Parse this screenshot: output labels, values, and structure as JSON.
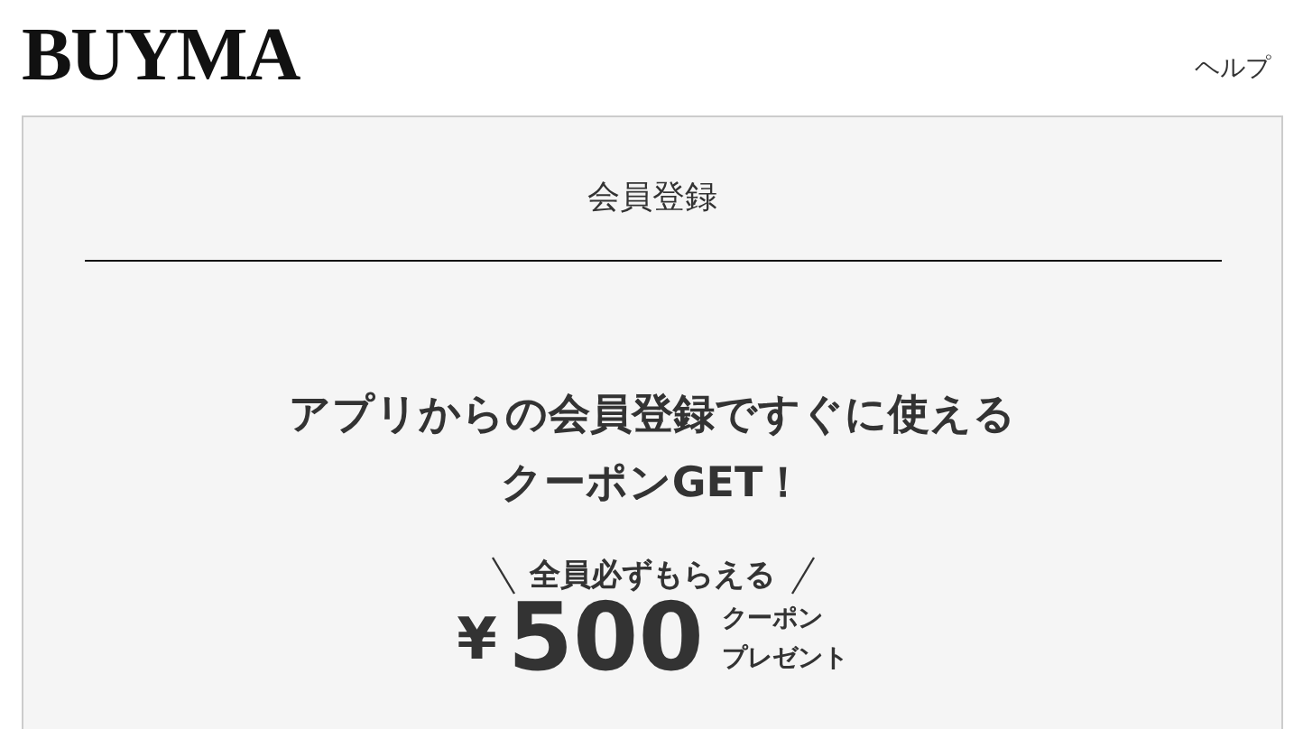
{
  "header": {
    "logo": "BUYMA",
    "help_link": "ヘルプ"
  },
  "panel": {
    "title": "会員登録",
    "headline_lines": [
      "アプリからの会員登録ですぐに使える",
      "クーポンGET！"
    ],
    "subtitle": "全員必ずもらえる",
    "offer": {
      "currency": "¥",
      "amount": "500",
      "note_lines": [
        "クーポン",
        "プレゼント"
      ]
    }
  }
}
